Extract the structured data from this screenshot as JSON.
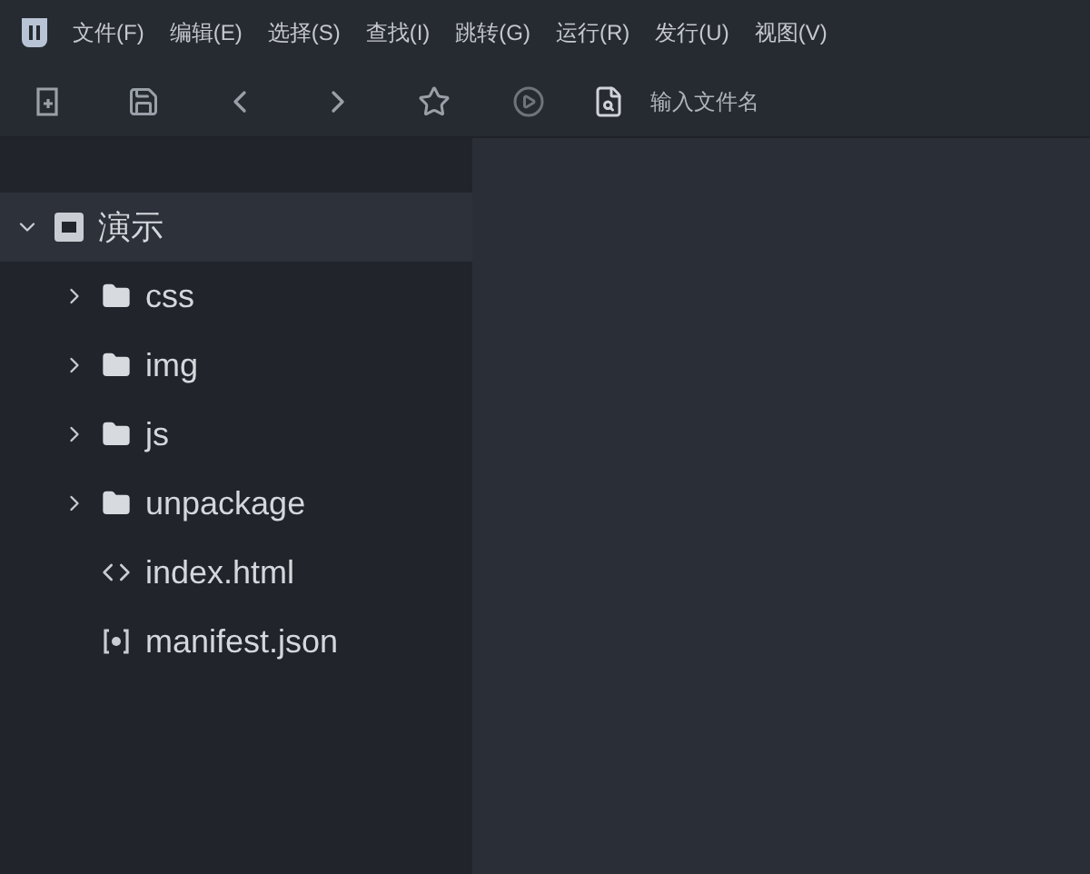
{
  "menu": [
    "文件(F)",
    "编辑(E)",
    "选择(S)",
    "查找(I)",
    "跳转(G)",
    "运行(R)",
    "发行(U)",
    "视图(V)"
  ],
  "toolbar": {
    "search": {
      "placeholder": "输入文件名"
    }
  },
  "tree": [
    {
      "label": "演示",
      "kind": "project",
      "expanded": true,
      "selected": true,
      "children": [
        {
          "label": "css",
          "kind": "folder",
          "expanded": false,
          "selected": false
        },
        {
          "label": "img",
          "kind": "folder",
          "expanded": false,
          "selected": false
        },
        {
          "label": "js",
          "kind": "folder",
          "expanded": false,
          "selected": false
        },
        {
          "label": "unpackage",
          "kind": "folder",
          "expanded": false,
          "selected": false
        },
        {
          "label": "index.html",
          "kind": "html",
          "selected": false
        },
        {
          "label": "manifest.json",
          "kind": "json",
          "selected": false
        }
      ]
    }
  ]
}
